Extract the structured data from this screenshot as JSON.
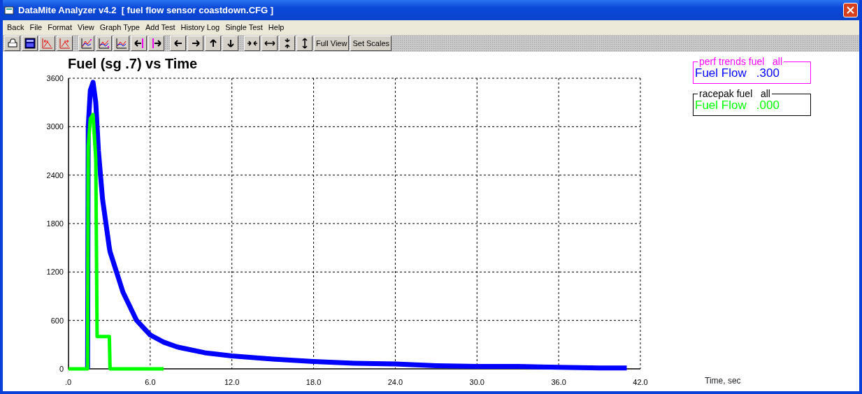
{
  "window": {
    "title": "DataMite Analyzer v4.2  [ fuel flow sensor coastdown.CFG ]"
  },
  "menu": [
    "Back",
    "File",
    "Format",
    "View",
    "Graph Type",
    "Add Test",
    "History Log",
    "Single Test",
    "Help"
  ],
  "toolbar": [
    [
      {
        "kind": "print"
      },
      {
        "kind": "screen"
      },
      {
        "kind": "shift-left"
      },
      {
        "kind": "shift-right"
      }
    ],
    [
      {
        "kind": "graph-a"
      },
      {
        "kind": "graph-b"
      },
      {
        "kind": "graph-c"
      },
      {
        "kind": "cursor-left"
      },
      {
        "kind": "cursor-right"
      }
    ],
    [
      {
        "kind": "left"
      },
      {
        "kind": "right"
      },
      {
        "kind": "up"
      },
      {
        "kind": "down"
      }
    ],
    [
      {
        "kind": "squeeze-h"
      },
      {
        "kind": "expand-h"
      },
      {
        "kind": "squeeze-v"
      },
      {
        "kind": "expand-v"
      },
      {
        "kind": "text",
        "label": "Full View"
      },
      {
        "kind": "text",
        "label": "Set Scales"
      }
    ]
  ],
  "chart": {
    "chart_data": {
      "type": "line",
      "title": "Fuel (sg .7) vs Time",
      "xlabel": "Time, sec",
      "x": [
        0,
        1.2,
        1.4,
        1.45,
        1.6,
        1.8,
        2.0,
        2.1,
        2.2,
        2.5,
        3.0,
        3.05,
        4,
        5,
        6,
        7,
        8,
        10,
        12,
        15,
        18,
        21,
        24,
        27,
        30,
        33,
        36,
        39,
        41
      ],
      "series": [
        {
          "name": "perf trends fuel",
          "color": "#0000ff",
          "values": [
            null,
            null,
            0,
            3000,
            3450,
            3550,
            3300,
            3000,
            2700,
            2100,
            1500,
            1450,
            950,
            600,
            420,
            330,
            270,
            200,
            160,
            120,
            90,
            70,
            60,
            40,
            30,
            30,
            20,
            10,
            10
          ]
        },
        {
          "name": "racepak fuel",
          "color": "#00ff00",
          "values": [
            0,
            0,
            0,
            2750,
            3100,
            3150,
            2600,
            400,
            400,
            400,
            400,
            0,
            0,
            0,
            0,
            0,
            null,
            null,
            null,
            null,
            null,
            null,
            null,
            null,
            null,
            null,
            null,
            null,
            null
          ]
        }
      ],
      "xlim": [
        0,
        42
      ],
      "ylim": [
        0,
        3600
      ],
      "grid": true,
      "xticks": [
        {
          "value": 0,
          "label": ".0"
        },
        {
          "value": 6,
          "label": "6.0"
        },
        {
          "value": 12,
          "label": "12.0"
        },
        {
          "value": 18,
          "label": "18.0"
        },
        {
          "value": 24,
          "label": "24.0"
        },
        {
          "value": 30,
          "label": "30.0"
        },
        {
          "value": 36,
          "label": "36.0"
        },
        {
          "value": 42,
          "label": "42.0"
        }
      ],
      "yticks": [
        0,
        600,
        1200,
        1800,
        2400,
        3000,
        3600
      ]
    },
    "legend": [
      {
        "scope": "all",
        "label": "Fuel Flow",
        "value": ".300",
        "color": "#ff00ff"
      },
      {
        "scope": "all",
        "label": "Fuel Flow",
        "value": ".000",
        "color": "#000000"
      }
    ]
  }
}
